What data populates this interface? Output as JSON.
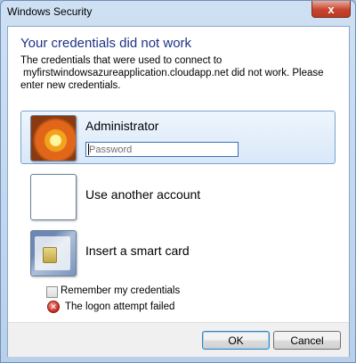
{
  "window": {
    "title": "Windows Security",
    "close_glyph": "x"
  },
  "dialog": {
    "heading": "Your credentials did not work",
    "description_lines": [
      "The credentials that were used to connect to",
      "myfirstwindowsazureapplication.cloudapp.net did not work. Please",
      "enter new credentials."
    ]
  },
  "tiles": [
    {
      "label": "Administrator",
      "icon": "flower-user-icon",
      "selected": true,
      "password_placeholder": "Password"
    },
    {
      "label": "Use another account",
      "icon": "blank-user-icon",
      "selected": false
    },
    {
      "label": "Insert a smart card",
      "icon": "smart-card-icon",
      "selected": false
    }
  ],
  "options": {
    "remember_label": "Remember my credentials",
    "remember_checked": false
  },
  "status": {
    "error_icon": "error-icon",
    "error_glyph": "✕",
    "error_text": "The logon attempt failed"
  },
  "buttons": {
    "ok_label": "OK",
    "cancel_label": "Cancel"
  },
  "colors": {
    "heading": "#1e3287",
    "selection": "#d9e8f9",
    "close_button": "#c7442d"
  }
}
